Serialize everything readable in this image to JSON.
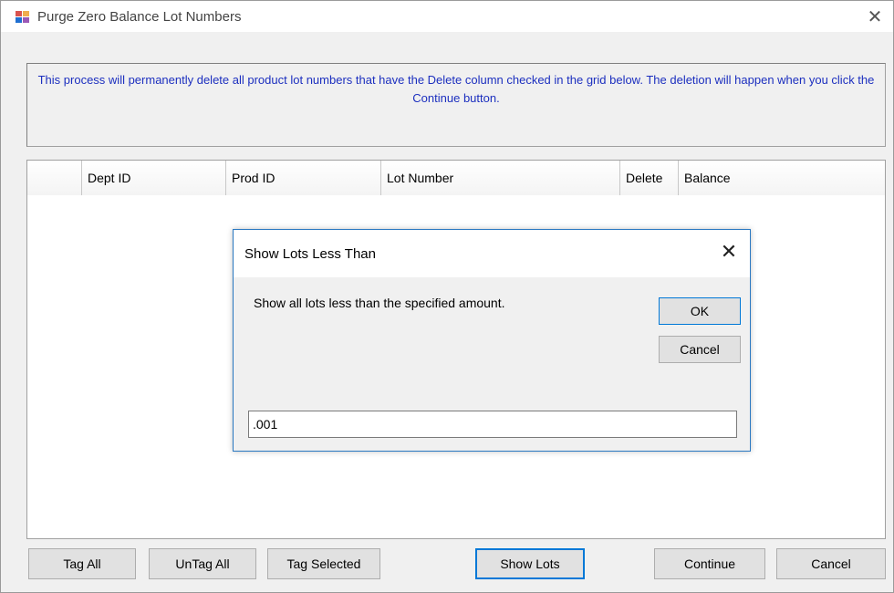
{
  "window": {
    "title": "Purge Zero Balance Lot Numbers",
    "close_glyph": "✕",
    "icon": "app-icon",
    "icon_colors": [
      "#d9534f",
      "#f0ad4e",
      "#1f6fd1",
      "#9b59b6"
    ]
  },
  "info": {
    "text": "This process will permanently delete all product lot numbers that have the Delete column checked in the grid below. The deletion will happen when you click the Continue button."
  },
  "grid": {
    "columns": [
      "",
      "Dept ID",
      "Prod ID",
      "Lot Number",
      "Delete",
      "Balance"
    ],
    "rows": []
  },
  "buttons": {
    "tag_all": "Tag All",
    "untag_all": "UnTag All",
    "tag_selected": "Tag Selected",
    "show_lots": "Show Lots",
    "continue": "Continue",
    "cancel": "Cancel"
  },
  "dialog": {
    "title": "Show Lots Less Than",
    "close_glyph": "✕",
    "message": "Show all lots less than the specified amount.",
    "ok": "OK",
    "cancel": "Cancel",
    "input_value": ".001"
  },
  "colors": {
    "accent": "#0078d7",
    "info_text": "#1c2fbf",
    "dialog_border": "#2b79c2"
  }
}
